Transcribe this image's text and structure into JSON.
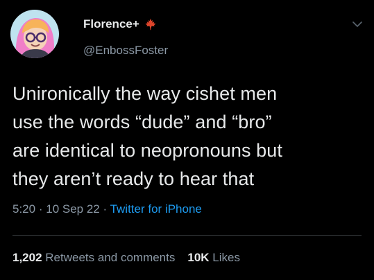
{
  "author": {
    "display_name": "Florence+",
    "handle": "@EnbossFoster",
    "badge_icon": "maple-leaf-icon",
    "avatar_colors": {
      "background": "#bfe3ef",
      "hair": "#f07ec8",
      "skin": "#f5d3b8",
      "glasses": "#4a2d6b"
    }
  },
  "tweet": {
    "text": "Unironically the way cishet men\nuse the words “dude” and “bro”\nare identical to neopronouns but\nthey aren’t ready to hear that",
    "time": "5:20",
    "date": "10 Sep 22",
    "separator": "·",
    "source": "Twitter for iPhone"
  },
  "stats": {
    "retweets_count": "1,202",
    "retweets_label": "Retweets and comments",
    "likes_count": "10K",
    "likes_label": "Likes"
  },
  "colors": {
    "background": "#000000",
    "text": "#e7e9ea",
    "secondary": "#8b98a5",
    "link": "#1d9bf0",
    "divider": "#2f3336",
    "badge": "#e0452b"
  }
}
